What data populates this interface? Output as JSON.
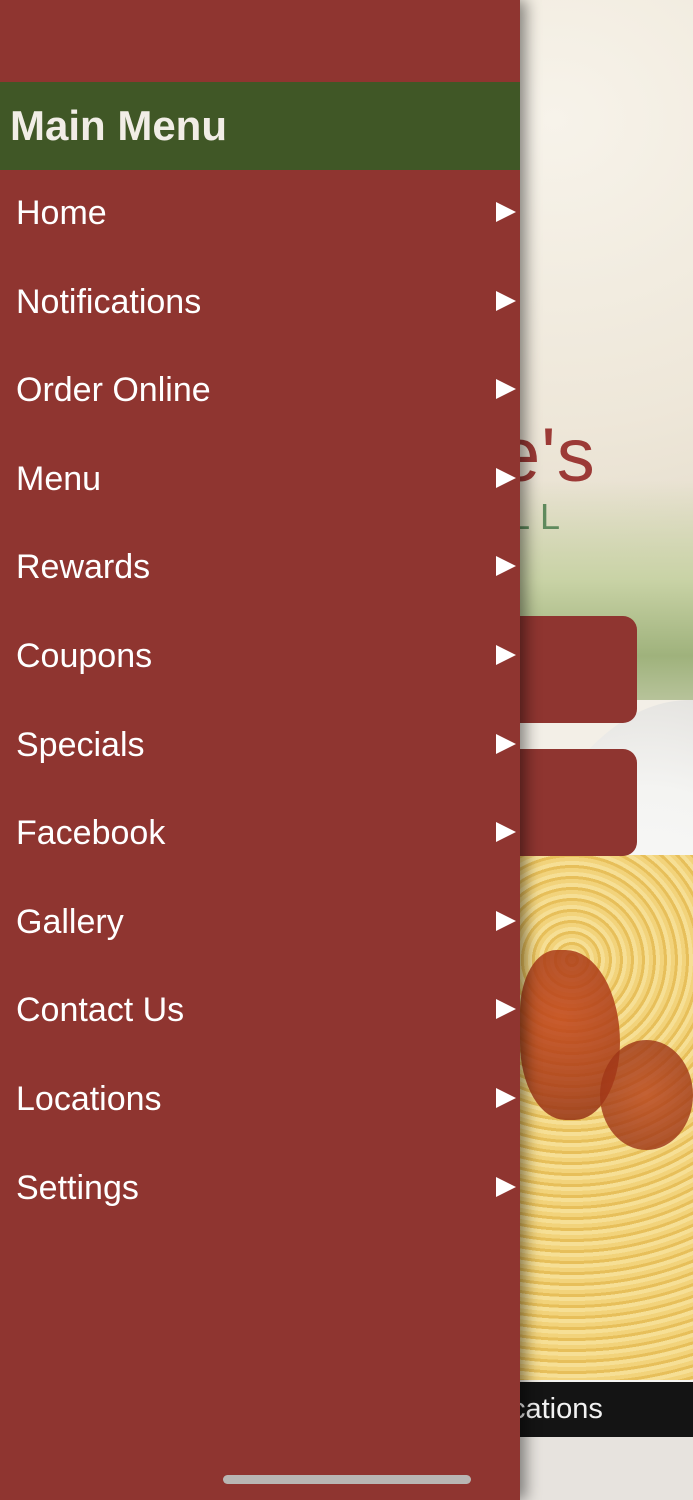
{
  "drawer": {
    "title": "Main Menu",
    "items": [
      {
        "label": "Home"
      },
      {
        "label": "Notifications"
      },
      {
        "label": "Order Online"
      },
      {
        "label": "Menu"
      },
      {
        "label": "Rewards"
      },
      {
        "label": "Coupons"
      },
      {
        "label": "Specials"
      },
      {
        "label": "Facebook"
      },
      {
        "label": "Gallery"
      },
      {
        "label": "Contact Us"
      },
      {
        "label": "Locations"
      },
      {
        "label": "Settings"
      }
    ],
    "arrow_icon": "triangle-right-icon"
  },
  "background": {
    "logo_partial": "e's",
    "logo_sub_partial": "LL",
    "tab_label_partial": "ifications"
  },
  "colors": {
    "drawer_bg": "#8f3530",
    "title_bar_bg": "#405726",
    "text": "#ffffff"
  }
}
